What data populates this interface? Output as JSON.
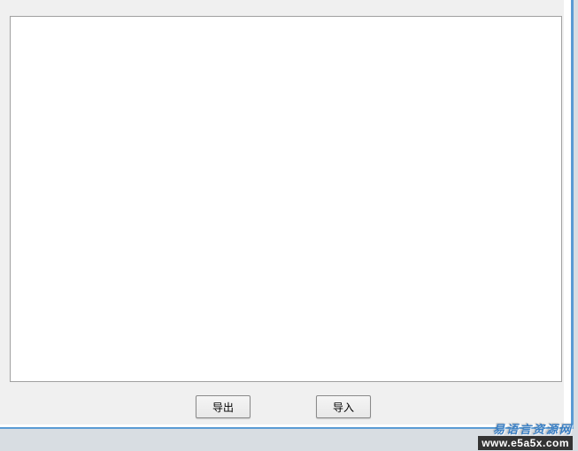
{
  "buttons": {
    "export_label": "导出",
    "import_label": "导入"
  },
  "watermark": {
    "title": "易语言资源网",
    "url": "www.e5a5x.com"
  }
}
